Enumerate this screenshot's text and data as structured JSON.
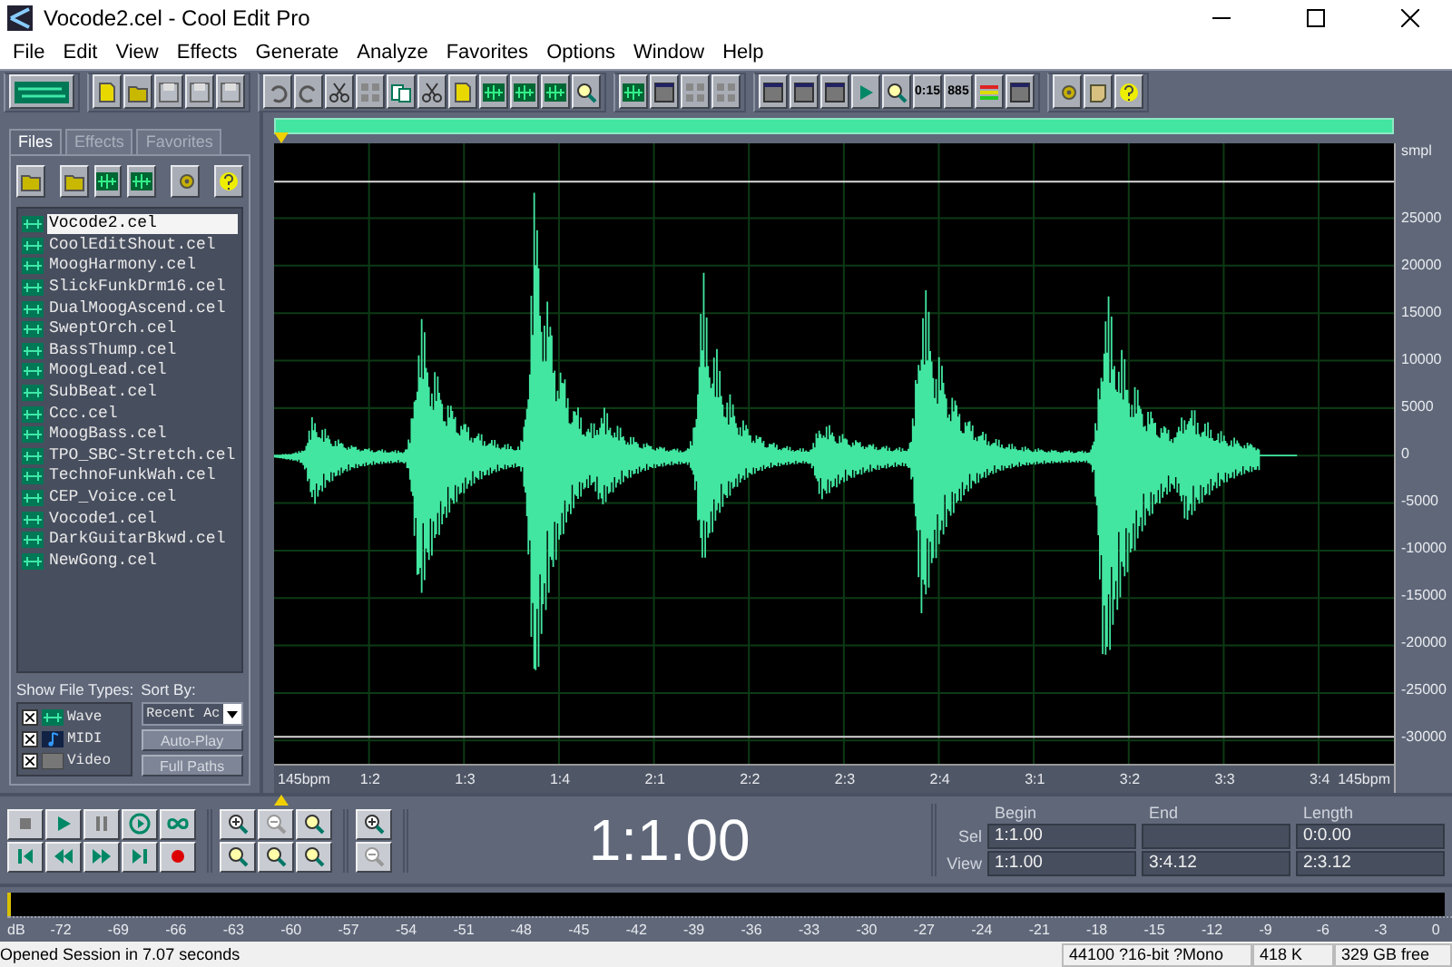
{
  "window": {
    "title": "Vocode2.cel - Cool Edit Pro"
  },
  "menu": [
    "File",
    "Edit",
    "View",
    "Effects",
    "Generate",
    "Analyze",
    "Favorites",
    "Options",
    "Window",
    "Help"
  ],
  "toolbar": {
    "time_label": "0:15",
    "count_label": "885"
  },
  "panel_tabs": [
    {
      "label": "Files",
      "selected": true
    },
    {
      "label": "Effects",
      "selected": false
    },
    {
      "label": "Favorites",
      "selected": false
    }
  ],
  "files": [
    {
      "name": "Vocode2.cel",
      "selected": true
    },
    {
      "name": "CoolEditShout.cel",
      "selected": false
    },
    {
      "name": "MoogHarmony.cel",
      "selected": false
    },
    {
      "name": "SlickFunkDrm16.cel",
      "selected": false
    },
    {
      "name": "DualMoogAscend.cel",
      "selected": false
    },
    {
      "name": "SweptOrch.cel",
      "selected": false
    },
    {
      "name": "BassThump.cel",
      "selected": false
    },
    {
      "name": "MoogLead.cel",
      "selected": false
    },
    {
      "name": "SubBeat.cel",
      "selected": false
    },
    {
      "name": "Ccc.cel",
      "selected": false
    },
    {
      "name": "MoogBass.cel",
      "selected": false
    },
    {
      "name": "TPO_SBC-Stretch.cel",
      "selected": false
    },
    {
      "name": "TechnoFunkWah.cel",
      "selected": false
    },
    {
      "name": "CEP_Voice.cel",
      "selected": false
    },
    {
      "name": "Vocode1.cel",
      "selected": false
    },
    {
      "name": "DarkGuitarBkwd.cel",
      "selected": false
    },
    {
      "name": "NewGong.cel",
      "selected": false
    }
  ],
  "file_types": {
    "label": "Show File Types:",
    "items": [
      {
        "label": "Wave",
        "kind": "wave",
        "checked": true
      },
      {
        "label": "MIDI",
        "kind": "midi",
        "checked": true
      },
      {
        "label": "Video",
        "kind": "video",
        "checked": true
      }
    ]
  },
  "sort": {
    "label": "Sort By:",
    "value": "Recent Ac"
  },
  "panel_buttons": [
    "Auto-Play",
    "Full Paths"
  ],
  "amplitude_axis": {
    "unit": "smpl",
    "labels": [
      "25000",
      "20000",
      "15000",
      "10000",
      "5000",
      "0",
      "-5000",
      "-10000",
      "-15000",
      "-20000",
      "-25000",
      "-30000"
    ]
  },
  "time_ruler": {
    "tempo_left": "145bpm",
    "tempo_right": "145bpm",
    "beats": [
      "1:2",
      "1:3",
      "1:4",
      "2:1",
      "2:2",
      "2:3",
      "2:4",
      "3:1",
      "3:2",
      "3:3",
      "3:4"
    ]
  },
  "time_display": "1:1.00",
  "selection": {
    "headers": [
      "Begin",
      "End",
      "Length"
    ],
    "rows": [
      {
        "label": "Sel",
        "begin": "1:1.00",
        "length": "0:0.00"
      },
      {
        "label": "View",
        "begin": "1:1.00",
        "end": "3:4.12",
        "length": "2:3.12"
      }
    ]
  },
  "level_meter": {
    "unit": "dB",
    "ticks": [
      "-72",
      "-69",
      "-66",
      "-63",
      "-60",
      "-57",
      "-54",
      "-51",
      "-48",
      "-45",
      "-42",
      "-39",
      "-36",
      "-33",
      "-30",
      "-27",
      "-24",
      "-21",
      "-18",
      "-15",
      "-12",
      "-9",
      "-6",
      "-3",
      "0"
    ]
  },
  "status_bar": {
    "message": "Opened Session in 7.07 seconds",
    "format": "44100 ?16-bit ?Mono",
    "size": "418 K",
    "free": "329 GB free"
  }
}
